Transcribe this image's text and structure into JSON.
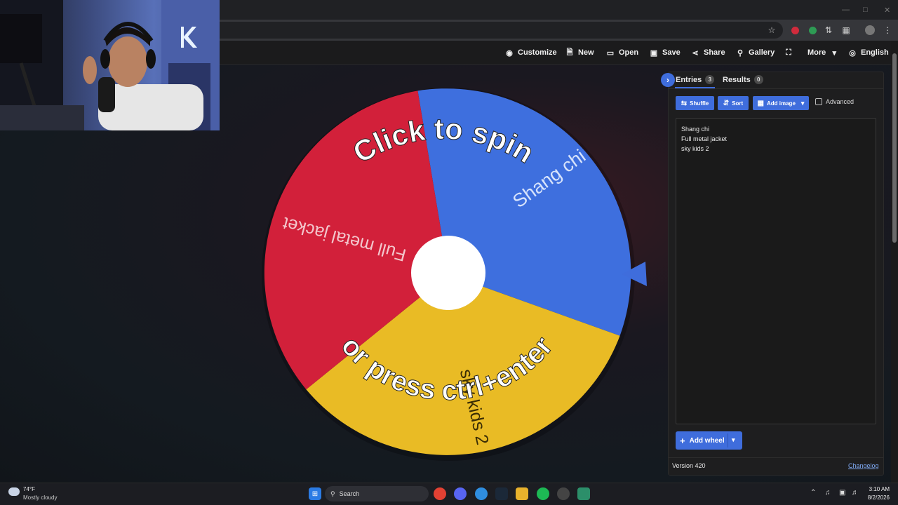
{
  "toolbar": {
    "customize": "Customize",
    "new": "New",
    "open": "Open",
    "save": "Save",
    "share": "Share",
    "gallery": "Gallery",
    "more": "More",
    "language": "English"
  },
  "wheel": {
    "spin_top": "Click to spin",
    "spin_bottom": "or press ctrl+enter",
    "segments": [
      {
        "label": "Shang chi",
        "color": "#3e6fde"
      },
      {
        "label": "sky kids 2",
        "color": "#e9bb25"
      },
      {
        "label": "Full metal jacket",
        "color": "#d2203a"
      }
    ],
    "pointer_color": "#3f6ddc"
  },
  "panel": {
    "tabs": [
      {
        "label": "Entries",
        "count": "3"
      },
      {
        "label": "Results",
        "count": "0"
      }
    ],
    "buttons": {
      "shuffle": "Shuffle",
      "sort": "Sort",
      "add_image": "Add image",
      "advanced": "Advanced"
    },
    "entries": [
      "Shang chi",
      "Full metal jacket",
      "sky kids 2"
    ],
    "add_wheel": "Add wheel",
    "version": "Version 420",
    "changelog": "Changelog"
  },
  "taskbar": {
    "weather_temp": "74°F",
    "weather_desc": "Mostly cloudy",
    "search": "Search",
    "time": "3:10 AM",
    "date": "8/2/2026"
  },
  "colors": {
    "accent": "#3f6ddc",
    "panel_bg": "#1e1e1f"
  }
}
